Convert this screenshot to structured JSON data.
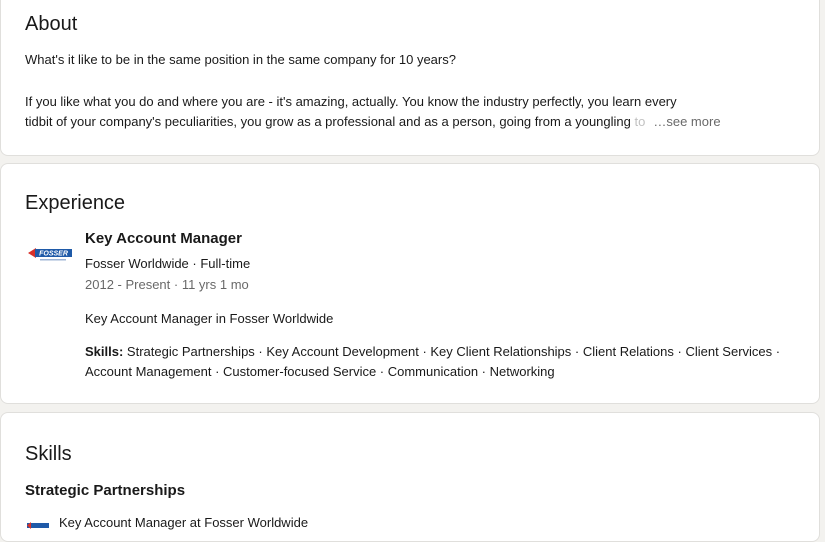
{
  "about": {
    "title": "About",
    "line1": "What's it like to be in the same position in the same company for 10 years?",
    "line2": "If you like what you do and where you are - it's amazing, actually. You know the industry perfectly, you learn every",
    "line3": "tidbit of your company's peculiarities, you grow as a professional and as a person, going from a youngling",
    "line3_fade": " to",
    "see_more": "…see more"
  },
  "experience": {
    "title": "Experience",
    "logo_text": "FOSSER",
    "role": "Key Account Manager",
    "company": "Fosser Worldwide · Full-time",
    "dates": "2012 - Present · 11 yrs 1 mo",
    "description": "Key Account Manager in Fosser Worldwide",
    "skills_label": "Skills:",
    "skills_text": " Strategic Partnerships · Key Account Development · Key Client Relationships · Client Relations · Client Services · Account Management · Customer-focused Service · Communication · Networking"
  },
  "skills": {
    "title": "Skills",
    "skill_name": "Strategic Partnerships",
    "skill_source": "Key Account Manager at Fosser Worldwide"
  },
  "colors": {
    "background": "#f3f2ef",
    "card": "#ffffff",
    "border": "#e0dfdc",
    "logo_blue": "#1f5aa8",
    "logo_red": "#d8312a"
  }
}
